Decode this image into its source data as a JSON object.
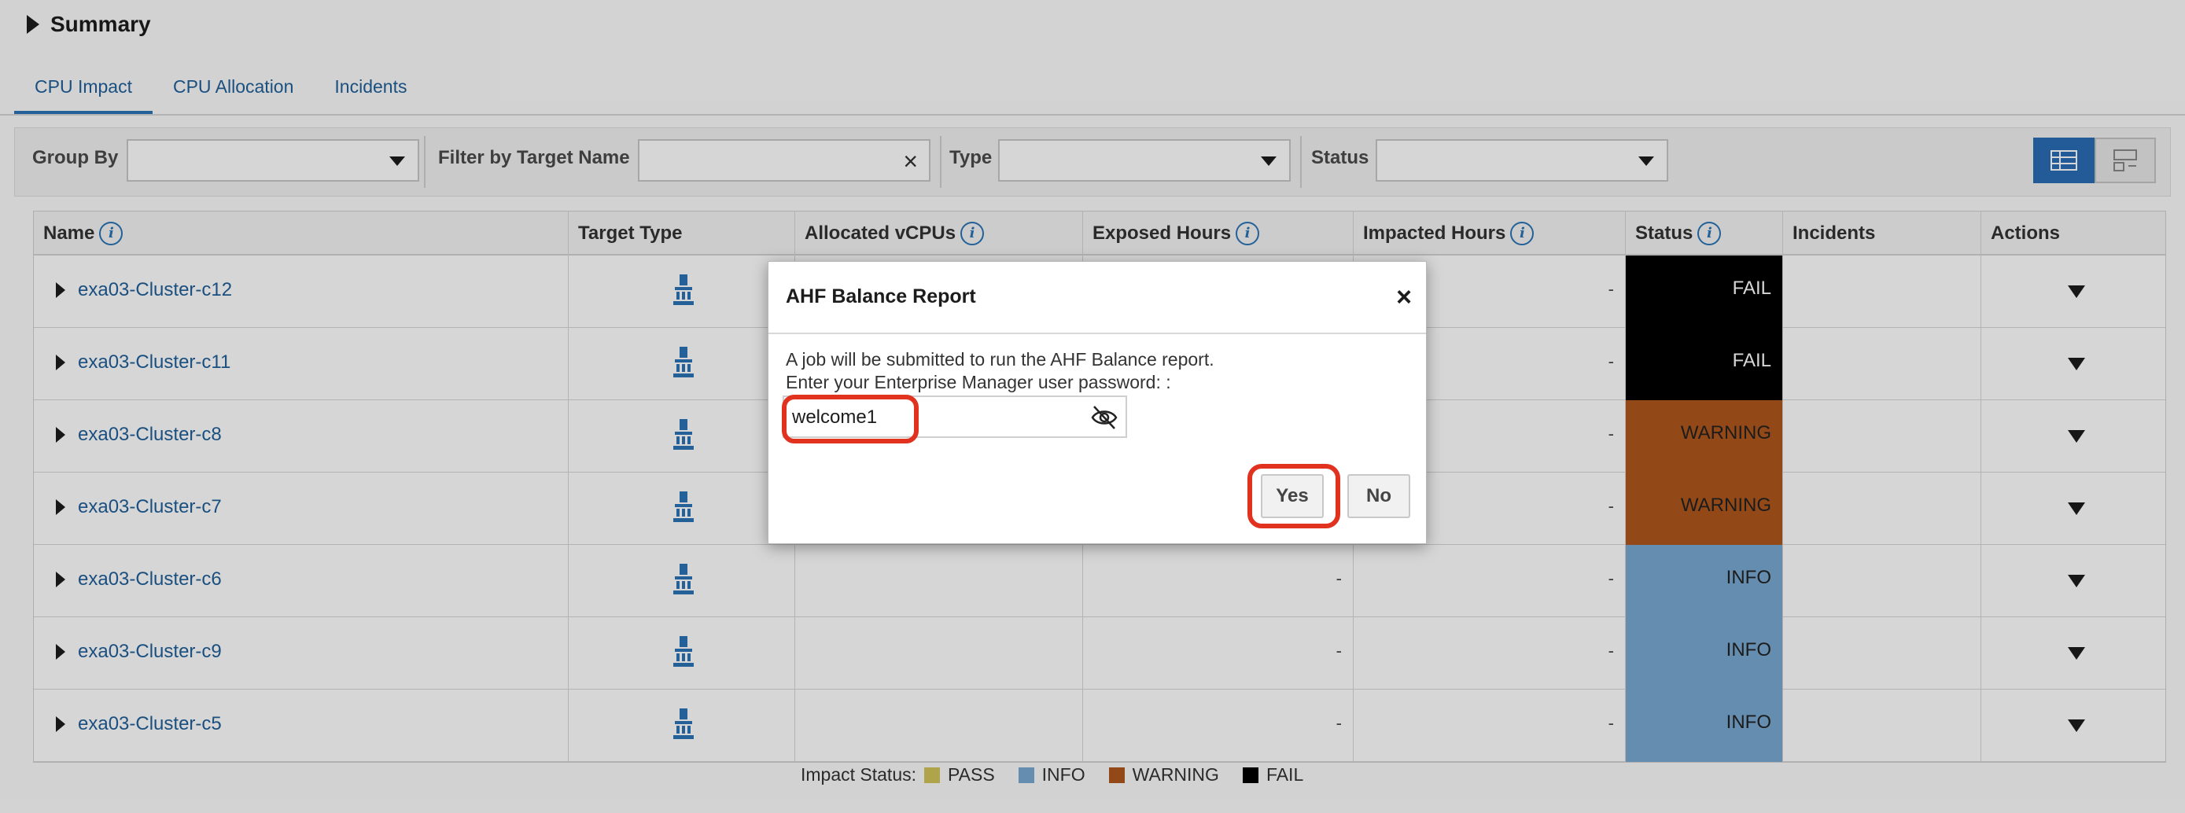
{
  "summary": {
    "title": "Summary"
  },
  "tabs": [
    {
      "label": "CPU Impact",
      "active": true
    },
    {
      "label": "CPU Allocation",
      "active": false
    },
    {
      "label": "Incidents",
      "active": false
    }
  ],
  "filters": {
    "group_by_label": "Group By",
    "group_by_value": "",
    "filter_target_label": "Filter by Target Name",
    "filter_target_value": "",
    "type_label": "Type",
    "type_value": "",
    "status_label": "Status",
    "status_value": ""
  },
  "table": {
    "columns": [
      "Name",
      "Target Type",
      "Allocated vCPUs",
      "Exposed Hours",
      "Impacted Hours",
      "Status",
      "Incidents",
      "Actions"
    ],
    "rows": [
      {
        "name": "exa03-Cluster-c12",
        "exposed": "",
        "impacted": "-",
        "status": "FAIL",
        "status_kind": "fail"
      },
      {
        "name": "exa03-Cluster-c11",
        "exposed": "",
        "impacted": "-",
        "status": "FAIL",
        "status_kind": "fail"
      },
      {
        "name": "exa03-Cluster-c8",
        "exposed": "",
        "impacted": "-",
        "status": "WARNING",
        "status_kind": "warn"
      },
      {
        "name": "exa03-Cluster-c7",
        "exposed": "",
        "impacted": "-",
        "status": "WARNING",
        "status_kind": "warn"
      },
      {
        "name": "exa03-Cluster-c6",
        "exposed": "-",
        "impacted": "-",
        "status": "INFO",
        "status_kind": "info"
      },
      {
        "name": "exa03-Cluster-c9",
        "exposed": "-",
        "impacted": "-",
        "status": "INFO",
        "status_kind": "info"
      },
      {
        "name": "exa03-Cluster-c5",
        "exposed": "-",
        "impacted": "-",
        "status": "INFO",
        "status_kind": "info"
      }
    ]
  },
  "legend": {
    "label": "Impact Status:",
    "items": [
      {
        "label": "PASS",
        "color": "#d2c45a"
      },
      {
        "label": "INFO",
        "color": "#79a9d2"
      },
      {
        "label": "WARNING",
        "color": "#b0581c"
      },
      {
        "label": "FAIL",
        "color": "#000000"
      }
    ]
  },
  "dialog": {
    "title": "AHF Balance Report",
    "message_line1": "A job will be submitted to run the AHF Balance report.",
    "message_line2": "Enter your Enterprise Manager user password: :",
    "password_value": "welcome1",
    "yes_label": "Yes",
    "no_label": "No"
  },
  "colors": {
    "accent": "#2a74b5",
    "highlight": "#e0321e",
    "fail": "#000000",
    "warning": "#b0581c",
    "info": "#79a9d2"
  }
}
